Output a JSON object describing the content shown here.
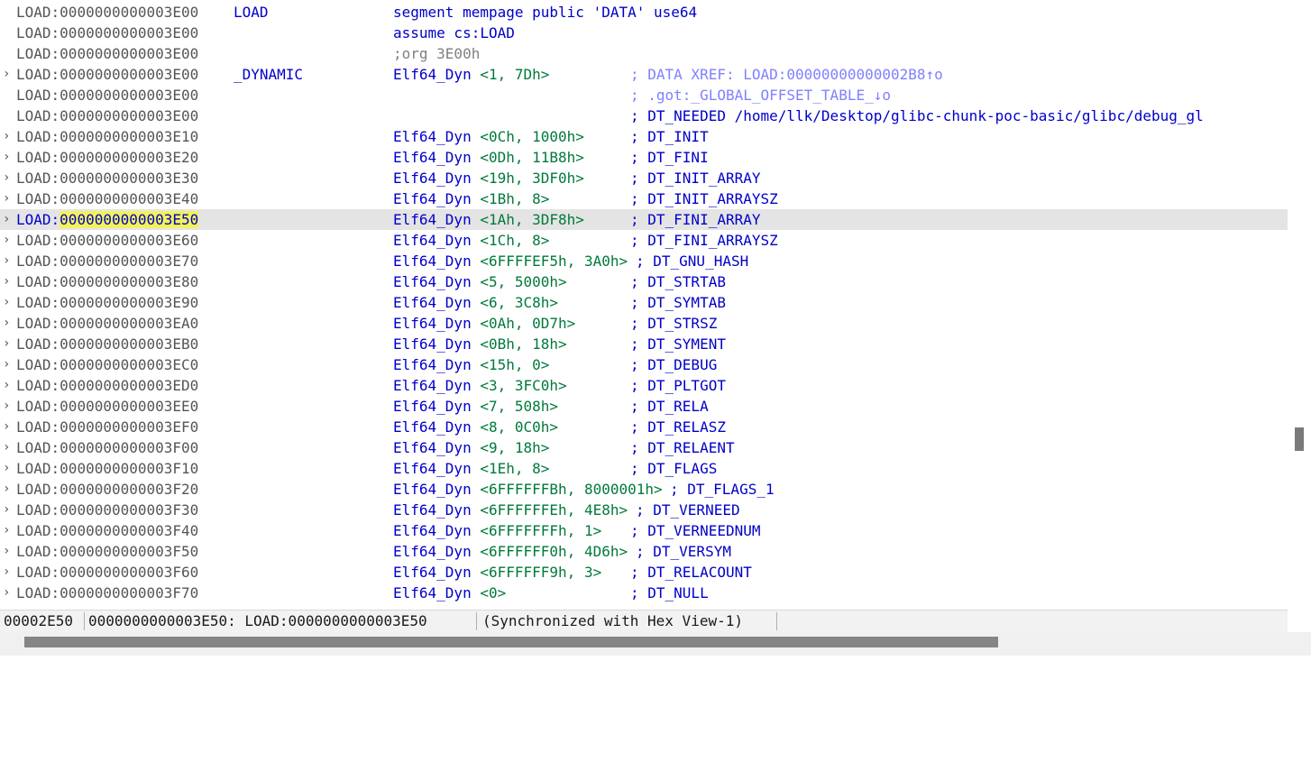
{
  "listing": {
    "rows": [
      {
        "seg": "LOAD:",
        "addr": "0000000000003E00",
        "arrow": "",
        "name": "LOAD",
        "op": "segment",
        "args": " mempage public 'DATA' use64",
        "kind": "directive",
        "comment": "",
        "xref": false
      },
      {
        "seg": "LOAD:",
        "addr": "0000000000003E00",
        "arrow": "",
        "name": "",
        "op": "assume",
        "args": " cs:LOAD",
        "kind": "directive",
        "comment": "",
        "xref": false
      },
      {
        "seg": "LOAD:",
        "addr": "0000000000003E00",
        "arrow": "",
        "name": "",
        "op": ";org 3E00h",
        "args": "",
        "kind": "org",
        "comment": "",
        "xref": false
      },
      {
        "seg": "LOAD:",
        "addr": "0000000000003E00",
        "arrow": "›",
        "name": "_DYNAMIC",
        "op": "Elf64_Dyn",
        "args": "<1, 7Dh>",
        "kind": "dyn",
        "comment": "; DATA XREF: LOAD:00000000000002B8↑o",
        "xref": true
      },
      {
        "seg": "LOAD:",
        "addr": "0000000000003E00",
        "arrow": "",
        "name": "",
        "op": "",
        "args": "",
        "kind": "none",
        "comment": "; .got:_GLOBAL_OFFSET_TABLE_↓o",
        "xref": true
      },
      {
        "seg": "LOAD:",
        "addr": "0000000000003E00",
        "arrow": "",
        "name": "",
        "op": "",
        "args": "",
        "kind": "none",
        "comment": "; DT_NEEDED /home/llk/Desktop/glibc-chunk-poc-basic/glibc/debug_gl",
        "xref": false
      },
      {
        "seg": "LOAD:",
        "addr": "0000000000003E10",
        "arrow": "›",
        "name": "",
        "op": "Elf64_Dyn",
        "args": "<0Ch, 1000h>",
        "kind": "dyn",
        "comment": "; DT_INIT",
        "xref": false
      },
      {
        "seg": "LOAD:",
        "addr": "0000000000003E20",
        "arrow": "›",
        "name": "",
        "op": "Elf64_Dyn",
        "args": "<0Dh, 11B8h>",
        "kind": "dyn",
        "comment": "; DT_FINI",
        "xref": false
      },
      {
        "seg": "LOAD:",
        "addr": "0000000000003E30",
        "arrow": "›",
        "name": "",
        "op": "Elf64_Dyn",
        "args": "<19h, 3DF0h>",
        "kind": "dyn",
        "comment": "; DT_INIT_ARRAY",
        "xref": false
      },
      {
        "seg": "LOAD:",
        "addr": "0000000000003E40",
        "arrow": "›",
        "name": "",
        "op": "Elf64_Dyn",
        "args": "<1Bh, 8>",
        "kind": "dyn",
        "comment": "; DT_INIT_ARRAYSZ",
        "xref": false
      },
      {
        "seg": "LOAD:",
        "addr": "0000000000003E50",
        "arrow": "›",
        "name": "",
        "op": "Elf64_Dyn",
        "args": "<1Ah, 3DF8h>",
        "kind": "dyn",
        "comment": "; DT_FINI_ARRAY",
        "xref": false,
        "selected": true
      },
      {
        "seg": "LOAD:",
        "addr": "0000000000003E60",
        "arrow": "›",
        "name": "",
        "op": "Elf64_Dyn",
        "args": "<1Ch, 8>",
        "kind": "dyn",
        "comment": "; DT_FINI_ARRAYSZ",
        "xref": false
      },
      {
        "seg": "LOAD:",
        "addr": "0000000000003E70",
        "arrow": "›",
        "name": "",
        "op": "Elf64_Dyn",
        "args": "<6FFFFEF5h, 3A0h>",
        "kind": "dyn",
        "comment": "; DT_GNU_HASH",
        "xref": false
      },
      {
        "seg": "LOAD:",
        "addr": "0000000000003E80",
        "arrow": "›",
        "name": "",
        "op": "Elf64_Dyn",
        "args": "<5, 5000h>",
        "kind": "dyn",
        "comment": "; DT_STRTAB",
        "xref": false
      },
      {
        "seg": "LOAD:",
        "addr": "0000000000003E90",
        "arrow": "›",
        "name": "",
        "op": "Elf64_Dyn",
        "args": "<6, 3C8h>",
        "kind": "dyn",
        "comment": "; DT_SYMTAB",
        "xref": false
      },
      {
        "seg": "LOAD:",
        "addr": "0000000000003EA0",
        "arrow": "›",
        "name": "",
        "op": "Elf64_Dyn",
        "args": "<0Ah, 0D7h>",
        "kind": "dyn",
        "comment": "; DT_STRSZ",
        "xref": false
      },
      {
        "seg": "LOAD:",
        "addr": "0000000000003EB0",
        "arrow": "›",
        "name": "",
        "op": "Elf64_Dyn",
        "args": "<0Bh, 18h>",
        "kind": "dyn",
        "comment": "; DT_SYMENT",
        "xref": false
      },
      {
        "seg": "LOAD:",
        "addr": "0000000000003EC0",
        "arrow": "›",
        "name": "",
        "op": "Elf64_Dyn",
        "args": "<15h, 0>",
        "kind": "dyn",
        "comment": "; DT_DEBUG",
        "xref": false
      },
      {
        "seg": "LOAD:",
        "addr": "0000000000003ED0",
        "arrow": "›",
        "name": "",
        "op": "Elf64_Dyn",
        "args": "<3, 3FC0h>",
        "kind": "dyn",
        "comment": "; DT_PLTGOT",
        "xref": false
      },
      {
        "seg": "LOAD:",
        "addr": "0000000000003EE0",
        "arrow": "›",
        "name": "",
        "op": "Elf64_Dyn",
        "args": "<7, 508h>",
        "kind": "dyn",
        "comment": "; DT_RELA",
        "xref": false
      },
      {
        "seg": "LOAD:",
        "addr": "0000000000003EF0",
        "arrow": "›",
        "name": "",
        "op": "Elf64_Dyn",
        "args": "<8, 0C0h>",
        "kind": "dyn",
        "comment": "; DT_RELASZ",
        "xref": false
      },
      {
        "seg": "LOAD:",
        "addr": "0000000000003F00",
        "arrow": "›",
        "name": "",
        "op": "Elf64_Dyn",
        "args": "<9, 18h>",
        "kind": "dyn",
        "comment": "; DT_RELAENT",
        "xref": false
      },
      {
        "seg": "LOAD:",
        "addr": "0000000000003F10",
        "arrow": "›",
        "name": "",
        "op": "Elf64_Dyn",
        "args": "<1Eh, 8>",
        "kind": "dyn",
        "comment": "; DT_FLAGS",
        "xref": false
      },
      {
        "seg": "LOAD:",
        "addr": "0000000000003F20",
        "arrow": "›",
        "name": "",
        "op": "Elf64_Dyn",
        "args": "<6FFFFFFBh, 8000001h>",
        "kind": "dyn",
        "comment": "; DT_FLAGS_1",
        "xref": false
      },
      {
        "seg": "LOAD:",
        "addr": "0000000000003F30",
        "arrow": "›",
        "name": "",
        "op": "Elf64_Dyn",
        "args": "<6FFFFFFEh, 4E8h>",
        "kind": "dyn",
        "comment": "; DT_VERNEED",
        "xref": false
      },
      {
        "seg": "LOAD:",
        "addr": "0000000000003F40",
        "arrow": "›",
        "name": "",
        "op": "Elf64_Dyn",
        "args": "<6FFFFFFFh, 1>",
        "kind": "dyn",
        "comment": "; DT_VERNEEDNUM",
        "xref": false
      },
      {
        "seg": "LOAD:",
        "addr": "0000000000003F50",
        "arrow": "›",
        "name": "",
        "op": "Elf64_Dyn",
        "args": "<6FFFFFF0h, 4D6h>",
        "kind": "dyn",
        "comment": "; DT_VERSYM",
        "xref": false
      },
      {
        "seg": "LOAD:",
        "addr": "0000000000003F60",
        "arrow": "›",
        "name": "",
        "op": "Elf64_Dyn",
        "args": "<6FFFFFF9h, 3>",
        "kind": "dyn",
        "comment": "; DT_RELACOUNT",
        "xref": false
      },
      {
        "seg": "LOAD:",
        "addr": "0000000000003F70",
        "arrow": "›",
        "name": "",
        "op": "Elf64_Dyn",
        "args": "<0>",
        "kind": "dyn",
        "comment": "; DT_NULL",
        "xref": false
      }
    ]
  },
  "status": {
    "offset": "00002E50",
    "address": "0000000000003E50: LOAD:0000000000003E50",
    "sync": "(Synchronized with Hex View-1)"
  },
  "colors": {
    "keyword": "#0000c8",
    "number": "#007a3a",
    "address": "#555555",
    "xref_comment": "#8080ff",
    "selection": "#e4e4e4",
    "address_highlight": "#f2f25a"
  },
  "icons": {
    "row_arrow": "chevron-right-icon"
  }
}
